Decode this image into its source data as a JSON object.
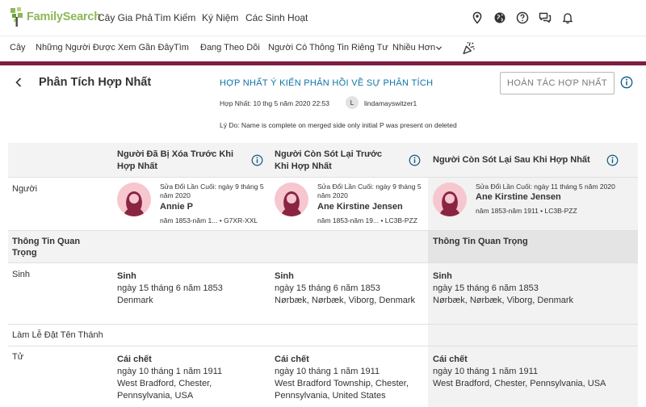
{
  "brand": {
    "name": "FamilySearch"
  },
  "top_nav": [
    "Cây Gia Phả",
    "Tìm Kiếm",
    "Ký Niệm",
    "Các Sinh Hoạt"
  ],
  "sub_nav": [
    "Cây",
    "Những Người Được Xem Gần Đây",
    "Tìm",
    "Đang Theo Dõi",
    "Người Có Thông Tin Riêng Tư",
    "Nhiều Hơn"
  ],
  "header": {
    "title": "Phân Tích Hợp Nhất",
    "merge_feedback": "HỢP NHẤT Ý KIẾN PHẢN HỒI VỀ SỰ PHÂN TÍCH",
    "undo_button": "HOÀN TÁC HỢP NHẤT",
    "merged_on": "Hợp Nhất: 10 thg 5 năm 2020 22:53",
    "user_initial": "L",
    "username": "lindamayswitzer1",
    "reason": "Lý Do: Name is complete on merged side only initial P was present on deleted"
  },
  "columns": {
    "deleted": "Người Đã Bị Xóa Trước Khi Hợp Nhất",
    "survived_before": "Người Còn Sót Lại Trước Khi Hợp Nhất",
    "survived_after": "Người Còn Sót Lại Sau Khi Hợp Nhất"
  },
  "rows": {
    "person": "Người",
    "vital_info": "Thông Tin Quan Trọng",
    "vital_info_after": "Thông Tin Quan Trọng",
    "birth": "Sinh",
    "christening": "Làm Lễ Đặt Tên Thánh",
    "death": "Tử"
  },
  "persons": {
    "deleted": {
      "edited": "Sửa Đổi Lần Cuối: ngày 9 tháng 5 năm 2020",
      "name": "Annie P",
      "years": "năm 1853-năm 1...",
      "pid": "G7XR-XXL"
    },
    "survived_before": {
      "edited": "Sửa Đổi Lần Cuối: ngày 9 tháng 5 năm 2020",
      "name": "Ane Kirstine Jensen",
      "years": "năm 1853-năm 19...",
      "pid": "LC3B-PZZ"
    },
    "survived_after": {
      "edited": "Sửa Đổi Lần Cuối: ngày 11 tháng 5 năm 2020",
      "name": "Ane Kirstine Jensen",
      "years": "năm 1853-năm 1911",
      "pid": "LC3B-PZZ"
    }
  },
  "birth": {
    "label": "Sinh",
    "deleted": {
      "date": "ngày 15 tháng 6 năm 1853",
      "place": "Denmark"
    },
    "survived_before": {
      "date": "ngày 15 tháng 6 năm 1853",
      "place": "Nørbæk, Nørbæk, Viborg, Denmark"
    },
    "survived_after": {
      "date": "ngày 15 tháng 6 năm 1853",
      "place": "Nørbæk, Nørbæk, Viborg, Denmark"
    }
  },
  "death": {
    "label": "Cái chết",
    "deleted": {
      "date": "ngày 10 tháng 1 năm 1911",
      "place": "West Bradford, Chester, Pennsylvania, USA"
    },
    "survived_before": {
      "date": "ngày 10 tháng 1 năm 1911",
      "place": "West Bradford Township, Chester, Pennsylvania, United States"
    },
    "survived_after": {
      "date": "ngày 10 tháng 1 năm 1911",
      "place": "West Bradford, Chester, Pennsylvania, USA"
    }
  },
  "colors": {
    "brand_green": "#8cb859",
    "accent_maroon": "#7f1d42",
    "link_blue": "#0e73a8"
  }
}
